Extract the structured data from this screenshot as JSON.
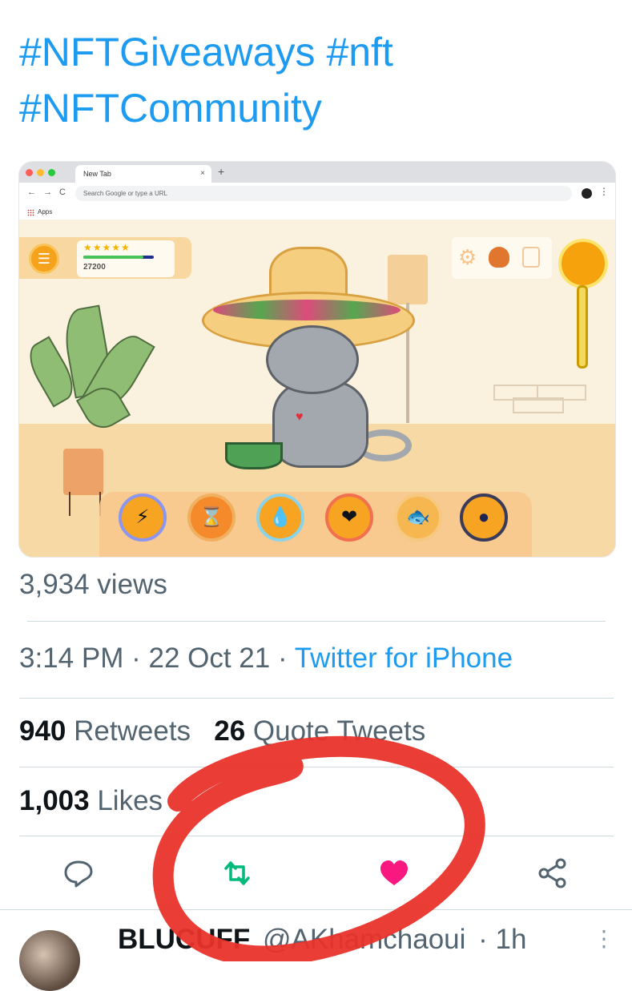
{
  "tweet": {
    "hashtags": [
      "#NFTGiveaways",
      "#nft",
      "#NFTCommunity"
    ]
  },
  "media": {
    "browser": {
      "tab_title": "New Tab",
      "tab_close": "×",
      "new_tab": "+",
      "nav_back": "←",
      "nav_forward": "→",
      "nav_reload": "C",
      "url_placeholder": "Search Google or type a URL",
      "menu": "⋮",
      "bookmark_apps": "Apps"
    },
    "game": {
      "menu_icon": "☰",
      "stars": "★★★★★",
      "coins": "27200",
      "xp_fraction": 0.85,
      "actions": [
        {
          "name": "energy",
          "glyph": "⚡"
        },
        {
          "name": "hourglass",
          "glyph": "⌛"
        },
        {
          "name": "water",
          "glyph": "💧"
        },
        {
          "name": "heart",
          "glyph": "❤"
        },
        {
          "name": "fish",
          "glyph": "🐟"
        },
        {
          "name": "paw",
          "glyph": "●"
        }
      ]
    }
  },
  "stats": {
    "views": "3,934 views",
    "time": "3:14 PM",
    "separator": "·",
    "date": "22 Oct 21",
    "client": "Twitter for iPhone",
    "retweets_count": "940",
    "retweets_label": "Retweets",
    "quotes_count": "26",
    "quotes_label": "Quote Tweets",
    "likes_count": "1,003",
    "likes_label": "Likes"
  },
  "reply": {
    "display_name": "BLUCUFF",
    "handle": "@AKhamchaoui",
    "time": "· 1h",
    "more": "⋮"
  },
  "colors": {
    "link": "#1d9bf0",
    "retweeted": "#00ba7c",
    "liked": "#f91880",
    "annotation": "#e8332a"
  }
}
